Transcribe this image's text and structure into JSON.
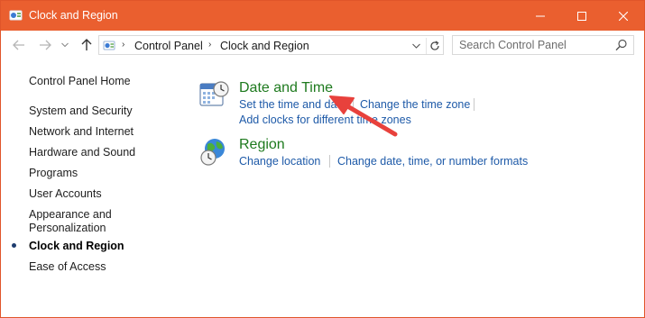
{
  "window": {
    "title": "Clock and Region",
    "icon": "control-panel-icon"
  },
  "navbar": {
    "breadcrumb": [
      "Control Panel",
      "Clock and Region"
    ],
    "search_placeholder": "Search Control Panel"
  },
  "sidebar": {
    "home": "Control Panel Home",
    "items": [
      {
        "label": "System and Security"
      },
      {
        "label": "Network and Internet"
      },
      {
        "label": "Hardware and Sound"
      },
      {
        "label": "Programs"
      },
      {
        "label": "User Accounts"
      },
      {
        "label": "Appearance and\nPersonalization"
      },
      {
        "label": "Clock and Region",
        "current": true
      },
      {
        "label": "Ease of Access"
      }
    ]
  },
  "main": {
    "categories": [
      {
        "title": "Date and Time",
        "icon": "date-time-icon",
        "links": [
          "Set the time and date",
          "Change the time zone",
          "Add clocks for different time zones"
        ]
      },
      {
        "title": "Region",
        "icon": "region-globe-icon",
        "links": [
          "Change location",
          "Change date, time, or number formats"
        ]
      }
    ]
  },
  "colors": {
    "titlebar": "#ea5f2f",
    "category_title": "#1e7a1e",
    "link": "#1e5aa8",
    "annotation_arrow": "#e8413c"
  }
}
